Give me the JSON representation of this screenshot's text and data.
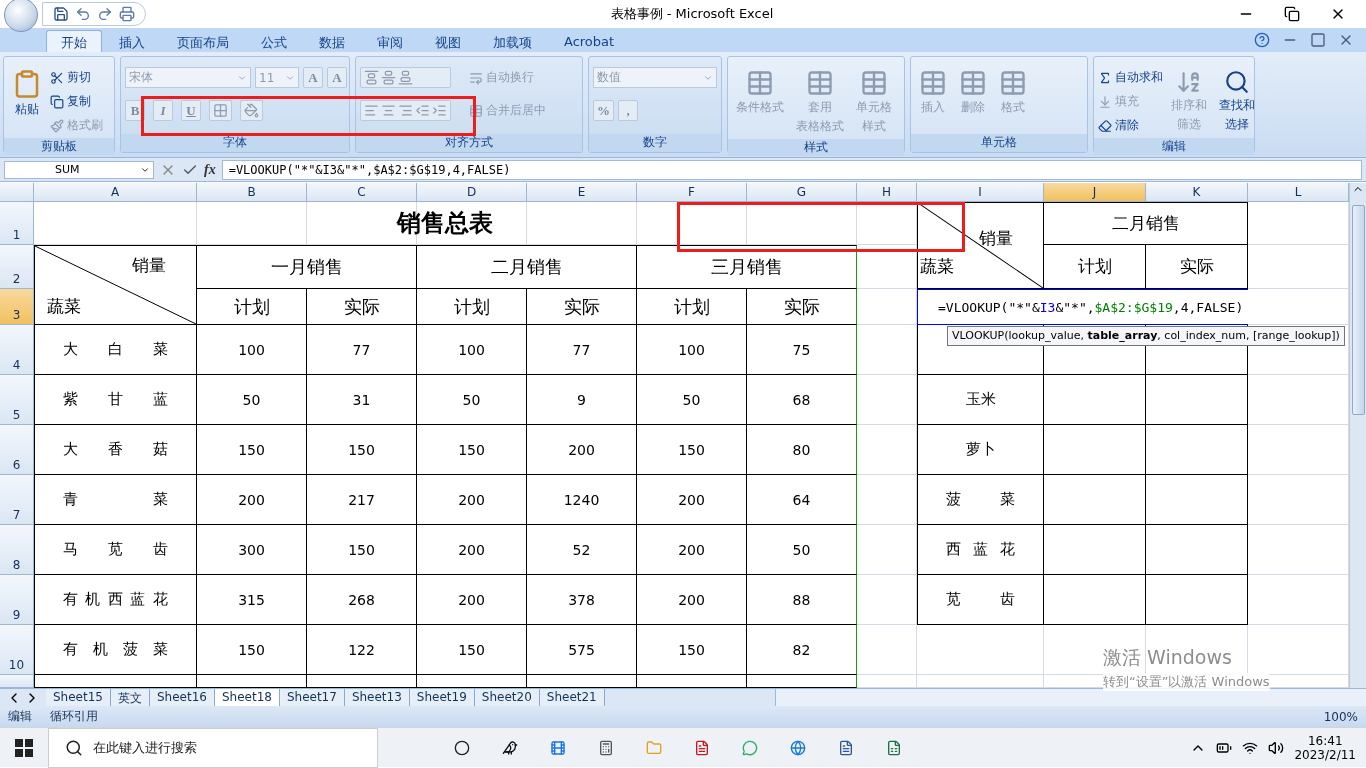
{
  "title_bar": {
    "title": "表格事例 - Microsoft Excel"
  },
  "ribbon": {
    "tabs": [
      {
        "label": "开始",
        "selected": true
      },
      {
        "label": "插入",
        "selected": false
      },
      {
        "label": "页面布局",
        "selected": false
      },
      {
        "label": "公式",
        "selected": false
      },
      {
        "label": "数据",
        "selected": false
      },
      {
        "label": "审阅",
        "selected": false
      },
      {
        "label": "视图",
        "selected": false
      },
      {
        "label": "加载项",
        "selected": false
      },
      {
        "label": "Acrobat",
        "selected": false
      }
    ],
    "groups": [
      {
        "kind": "clipboard",
        "label": "剪贴板",
        "large": {
          "label": "粘贴",
          "disabled": false
        },
        "small": [
          {
            "label": "剪切",
            "disabled": false
          },
          {
            "label": "复制",
            "disabled": false
          },
          {
            "label": "格式刷",
            "disabled": true
          }
        ]
      },
      {
        "kind": "font",
        "label": "字体",
        "disabled": true,
        "font": "宋体",
        "size": "11",
        "grow": [
          "A",
          "A"
        ],
        "styles": [
          "B",
          "I",
          "U"
        ]
      },
      {
        "kind": "alignment",
        "label": "对齐方式",
        "disabled": true,
        "small": [
          {
            "label": "自动换行",
            "disabled": true
          },
          {
            "label": "合并后居中",
            "disabled": true
          }
        ]
      },
      {
        "kind": "number",
        "label": "数字",
        "disabled": true,
        "format": "数值",
        "symbols": [
          "%",
          ","
        ]
      },
      {
        "kind": "large_buttons",
        "label": "样式",
        "items": [
          {
            "lines": [
              "条件格式"
            ],
            "disabled": true
          },
          {
            "lines": [
              "套用",
              "表格格式"
            ],
            "disabled": true
          },
          {
            "lines": [
              "单元格",
              "样式"
            ],
            "disabled": true
          }
        ]
      },
      {
        "kind": "large_buttons",
        "label": "单元格",
        "items": [
          {
            "lines": [
              "插入"
            ],
            "disabled": true
          },
          {
            "lines": [
              "删除"
            ],
            "disabled": true
          },
          {
            "lines": [
              "格式"
            ],
            "disabled": true
          }
        ]
      },
      {
        "kind": "editing",
        "label": "编辑",
        "small": [
          {
            "label": "自动求和",
            "disabled": false
          },
          {
            "label": "填充",
            "disabled": true
          },
          {
            "label": "清除",
            "disabled": false
          }
        ],
        "large": [
          {
            "lines": [
              "排序和",
              "筛选"
            ],
            "disabled": true
          },
          {
            "lines": [
              "查找和",
              "选择"
            ],
            "disabled": false
          }
        ]
      }
    ]
  },
  "formula_bar": {
    "name_box": "SUM",
    "fx": "fx",
    "formula": "=VLOOKUP(\"*\"&I3&\"*\",$A$2:$G$19,4,FALSE)"
  },
  "columns": [
    {
      "label": "A",
      "selected": false
    },
    {
      "label": "B",
      "selected": false
    },
    {
      "label": "C",
      "selected": false
    },
    {
      "label": "D",
      "selected": false
    },
    {
      "label": "E",
      "selected": false
    },
    {
      "label": "F",
      "selected": false
    },
    {
      "label": "G",
      "selected": false
    },
    {
      "label": "H",
      "selected": false
    },
    {
      "label": "I",
      "selected": false
    },
    {
      "label": "J",
      "selected": true
    },
    {
      "label": "K",
      "selected": false
    },
    {
      "label": "L",
      "selected": false
    }
  ],
  "rows": [
    {
      "label": "1",
      "selected": false
    },
    {
      "label": "2",
      "selected": false
    },
    {
      "label": "3",
      "selected": true
    },
    {
      "label": "4",
      "selected": false
    },
    {
      "label": "5",
      "selected": false
    },
    {
      "label": "6",
      "selected": false
    },
    {
      "label": "7",
      "selected": false
    },
    {
      "label": "8",
      "selected": false
    },
    {
      "label": "9",
      "selected": false
    },
    {
      "label": "10",
      "selected": false
    }
  ],
  "sales_table": {
    "title": "销售总表",
    "corner": {
      "top": "销量",
      "bottom": "蔬菜"
    },
    "months": [
      "一月销售",
      "二月销售",
      "三月销售"
    ],
    "sub_headers": [
      "计划",
      "实际",
      "计划",
      "实际",
      "计划",
      "实际"
    ],
    "rows": [
      {
        "name": "大 白 菜",
        "values": [
          "100",
          "77",
          "100",
          "77",
          "100",
          "75"
        ]
      },
      {
        "name": "紫 甘 蓝",
        "values": [
          "50",
          "31",
          "50",
          "9",
          "50",
          "68"
        ]
      },
      {
        "name": "大 香 菇",
        "values": [
          "150",
          "150",
          "150",
          "200",
          "150",
          "80"
        ]
      },
      {
        "name": "青 菜",
        "values": [
          "200",
          "217",
          "200",
          "1240",
          "200",
          "64"
        ]
      },
      {
        "name": "马 苋 齿",
        "values": [
          "300",
          "150",
          "200",
          "52",
          "200",
          "50"
        ]
      },
      {
        "name": "有 机 西 蓝 花",
        "values": [
          "315",
          "268",
          "200",
          "378",
          "200",
          "88"
        ]
      },
      {
        "name": "有 机 菠 菜",
        "values": [
          "150",
          "122",
          "150",
          "575",
          "150",
          "82"
        ]
      }
    ]
  },
  "lookup_table": {
    "corner": {
      "top": "销量",
      "bottom": "蔬菜"
    },
    "month": "二月销售",
    "sub_headers": [
      "计划",
      "实际"
    ],
    "edit_cell": {
      "segments": [
        {
          "text": "=VLOOKUP(\"*\"&",
          "color": "#000000"
        },
        {
          "text": "I3",
          "color": "#0000ff"
        },
        {
          "text": "&\"*\",",
          "color": "#000000"
        },
        {
          "text": "$A$2:$G$19",
          "color": "#008000"
        },
        {
          "text": ",4,FALSE)",
          "color": "#000000"
        }
      ]
    },
    "rows": [
      {
        "name": "玉米",
        "distributed": false
      },
      {
        "name": "萝卜",
        "distributed": false
      },
      {
        "name": "菠 菜",
        "distributed": true
      },
      {
        "name": "西 蓝 花",
        "distributed": true
      },
      {
        "name": "苋 齿",
        "distributed": true
      }
    ]
  },
  "tooltip": "VLOOKUP(lookup_value, **table_array**, col_index_num, [range_lookup])",
  "sheet_tabs": [
    {
      "label": "Sheet15",
      "selected": false
    },
    {
      "label": "英文",
      "selected": false
    },
    {
      "label": "Sheet16",
      "selected": false
    },
    {
      "label": "Sheet18",
      "selected": true
    },
    {
      "label": "Sheet17",
      "selected": false
    },
    {
      "label": "Sheet13",
      "selected": false
    },
    {
      "label": "Sheet19",
      "selected": false
    },
    {
      "label": "Sheet20",
      "selected": false
    },
    {
      "label": "Sheet21",
      "selected": false
    }
  ],
  "status_bar": {
    "mode": "编辑",
    "message": "循环引用",
    "zoom": "100%"
  },
  "activation": {
    "title": "激活 Windows",
    "hint": "转到“设置”以激活 Windows"
  },
  "taskbar": {
    "search_placeholder": "在此键入进行搜索",
    "time": "16:41",
    "date": "2023/2/11"
  }
}
